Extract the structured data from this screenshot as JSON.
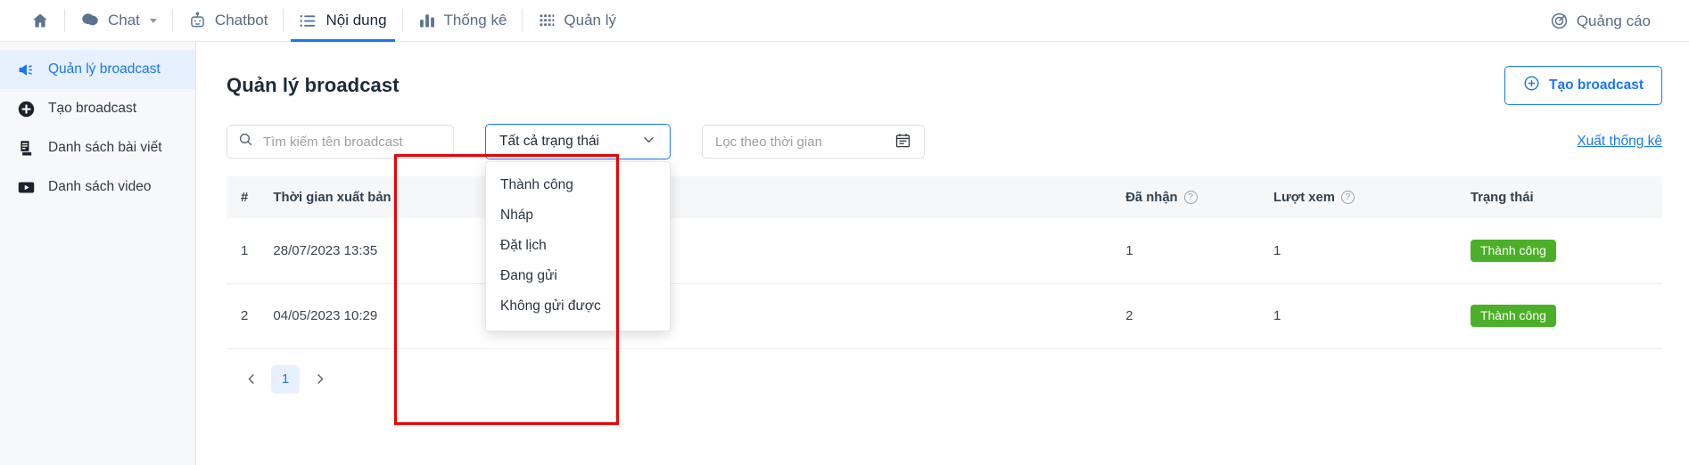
{
  "topnav": {
    "home_icon": "home-icon",
    "items": [
      {
        "label": "Chat",
        "icon": "chat-bubbles-icon",
        "has_caret": true,
        "active": false
      },
      {
        "label": "Chatbot",
        "icon": "robot-icon",
        "has_caret": false,
        "active": false
      },
      {
        "label": "Nội dung",
        "icon": "list-lines-icon",
        "has_caret": false,
        "active": true
      },
      {
        "label": "Thống kê",
        "icon": "bar-chart-icon",
        "has_caret": false,
        "active": false
      },
      {
        "label": "Quản lý",
        "icon": "grid-dots-icon",
        "has_caret": false,
        "active": false
      }
    ],
    "right": {
      "label": "Quảng cáo",
      "icon": "target-icon"
    }
  },
  "sidebar": {
    "items": [
      {
        "label": "Quản lý broadcast",
        "icon": "megaphone-icon",
        "active": true
      },
      {
        "label": "Tạo broadcast",
        "icon": "plus-circle-icon",
        "active": false
      },
      {
        "label": "Danh sách bài viết",
        "icon": "article-icon",
        "active": false
      },
      {
        "label": "Danh sách video",
        "icon": "video-play-icon",
        "active": false
      }
    ]
  },
  "main": {
    "title": "Quản lý broadcast",
    "create_button": "Tạo broadcast",
    "export_link": "Xuất thống kê"
  },
  "filters": {
    "search_placeholder": "Tìm kiếm tên broadcast",
    "search_value": "",
    "status_selected": "Tất cả trạng thái",
    "date_placeholder": "Lọc theo thời gian",
    "status_options": [
      "Thành công",
      "Nháp",
      "Đặt lịch",
      "Đang gửi",
      "Không gửi được"
    ]
  },
  "table": {
    "columns": [
      "#",
      "Thời gian xuất bản",
      "",
      "",
      "Đã nhận",
      "Lượt xem",
      "Trạng thái"
    ],
    "rows": [
      {
        "index": "1",
        "published_at": "28/07/2023 13:35",
        "name": "",
        "sent": "",
        "received": "1",
        "views": "1",
        "status": "Thành công"
      },
      {
        "index": "2",
        "published_at": "04/05/2023 10:29",
        "name": "",
        "sent": "",
        "received": "2",
        "views": "1",
        "status": "Thành công"
      }
    ]
  },
  "pagination": {
    "prev": "‹",
    "next": "›",
    "pages": [
      "1"
    ],
    "current": "1"
  },
  "colors": {
    "accent": "#1877f2",
    "success": "#4caf28",
    "highlight_box": "#f10000",
    "sidebar_bg": "#f7f8fa"
  }
}
